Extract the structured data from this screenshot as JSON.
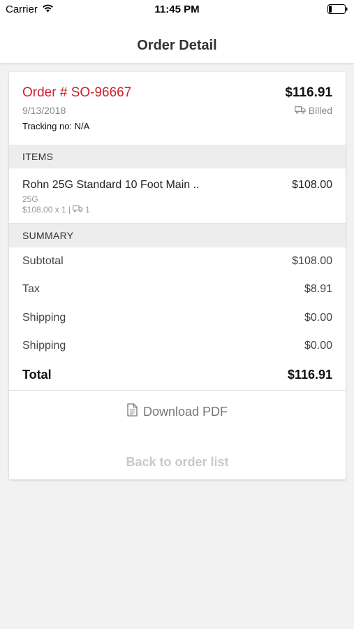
{
  "status_bar": {
    "carrier": "Carrier",
    "time": "11:45 PM"
  },
  "nav": {
    "title": "Order Detail"
  },
  "order": {
    "number": "Order # SO-96667",
    "total": "$116.91",
    "date": "9/13/2018",
    "status": "Billed",
    "tracking": "Tracking no: N/A"
  },
  "items_section": {
    "title": "ITEMS"
  },
  "items": [
    {
      "name": "Rohn 25G Standard 10 Foot Main ..",
      "price": "$108.00",
      "sku": "25G",
      "price_qty": "$108.00 x 1 |",
      "shipped_qty": "1"
    }
  ],
  "summary_section": {
    "title": "SUMMARY"
  },
  "summary": {
    "subtotal_label": "Subtotal",
    "subtotal_value": "$108.00",
    "tax_label": "Tax",
    "tax_value": "$8.91",
    "shipping1_label": "Shipping",
    "shipping1_value": "$0.00",
    "shipping2_label": "Shipping",
    "shipping2_value": "$0.00",
    "total_label": "Total",
    "total_value": "$116.91"
  },
  "actions": {
    "download_pdf": "Download PDF",
    "back": "Back to order list"
  },
  "colors": {
    "accent_red": "#d0202e",
    "background": "#f2f2f2",
    "muted": "#8a8a8a"
  },
  "icons": {
    "status": "truck-icon",
    "download": "document-icon",
    "signal": "wifi-icon",
    "battery": "battery-icon"
  }
}
